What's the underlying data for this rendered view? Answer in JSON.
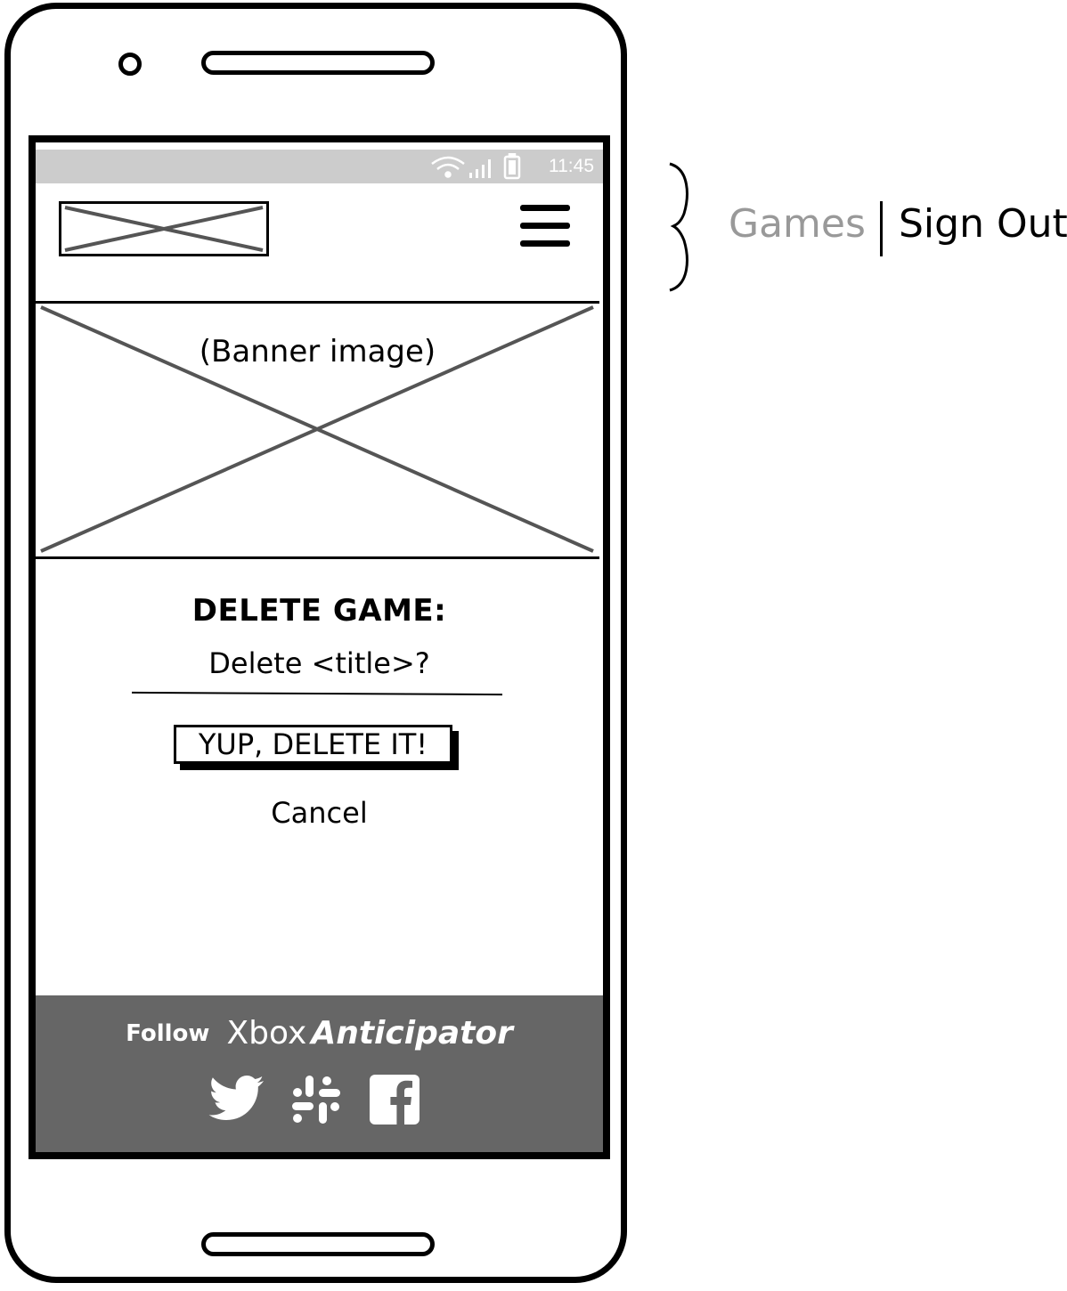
{
  "status_bar": {
    "time": "11:45"
  },
  "header": {
    "logo_icon": "image-placeholder-icon",
    "menu_icon": "hamburger-menu-icon"
  },
  "banner": {
    "label": "(Banner image)"
  },
  "delete": {
    "heading": "DELETE GAME:",
    "question": "Delete <title>?",
    "confirm_label": "YUP, DELETE IT!",
    "cancel_label": "Cancel"
  },
  "footer": {
    "follow_label": "Follow",
    "brand_first": "Xbox",
    "brand_second": "Anticipator",
    "socials": [
      "twitter-icon",
      "slack-icon",
      "facebook-icon"
    ],
    "background": "#666666"
  },
  "annotation": {
    "games_label": "Games",
    "signout_label": "Sign Out",
    "games_color": "#999999"
  }
}
